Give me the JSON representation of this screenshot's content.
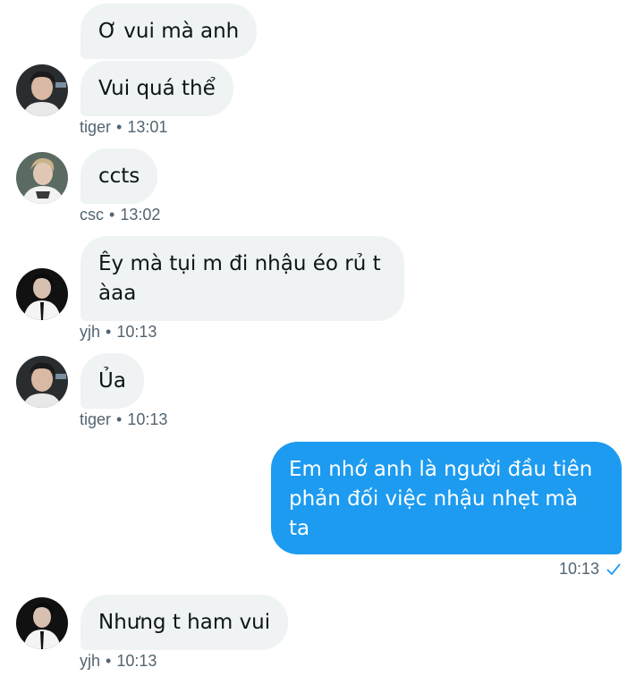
{
  "messages": [
    {
      "sender": "tiger",
      "text": "Ơ vui mà anh"
    },
    {
      "sender": "tiger",
      "text": "Vui quá thể",
      "time": "13:01"
    },
    {
      "sender": "csc",
      "text": "ccts",
      "time": "13:02"
    },
    {
      "sender": "yjh",
      "text": "Êy mà tụi m đi nhậu éo rủ t\nàaa",
      "time": "10:13"
    },
    {
      "sender": "tiger",
      "text": "Ủa",
      "time": "10:13"
    },
    {
      "sender": "me",
      "text": "Em nhớ anh là người đầu tiên\nphản đối việc nhậu nhẹt mà\nta",
      "time": "10:13"
    },
    {
      "sender": "yjh",
      "text": "Nhưng t ham vui",
      "time": "10:13"
    }
  ],
  "separator": "•",
  "colors": {
    "incoming_bubble": "#eff3f4",
    "outgoing_bubble": "#1d9bf0",
    "meta_text": "#536471",
    "read_check": "#1d9bf0"
  },
  "icons": [
    "avatar-tiger",
    "avatar-csc",
    "avatar-yjh",
    "read-check-icon"
  ]
}
